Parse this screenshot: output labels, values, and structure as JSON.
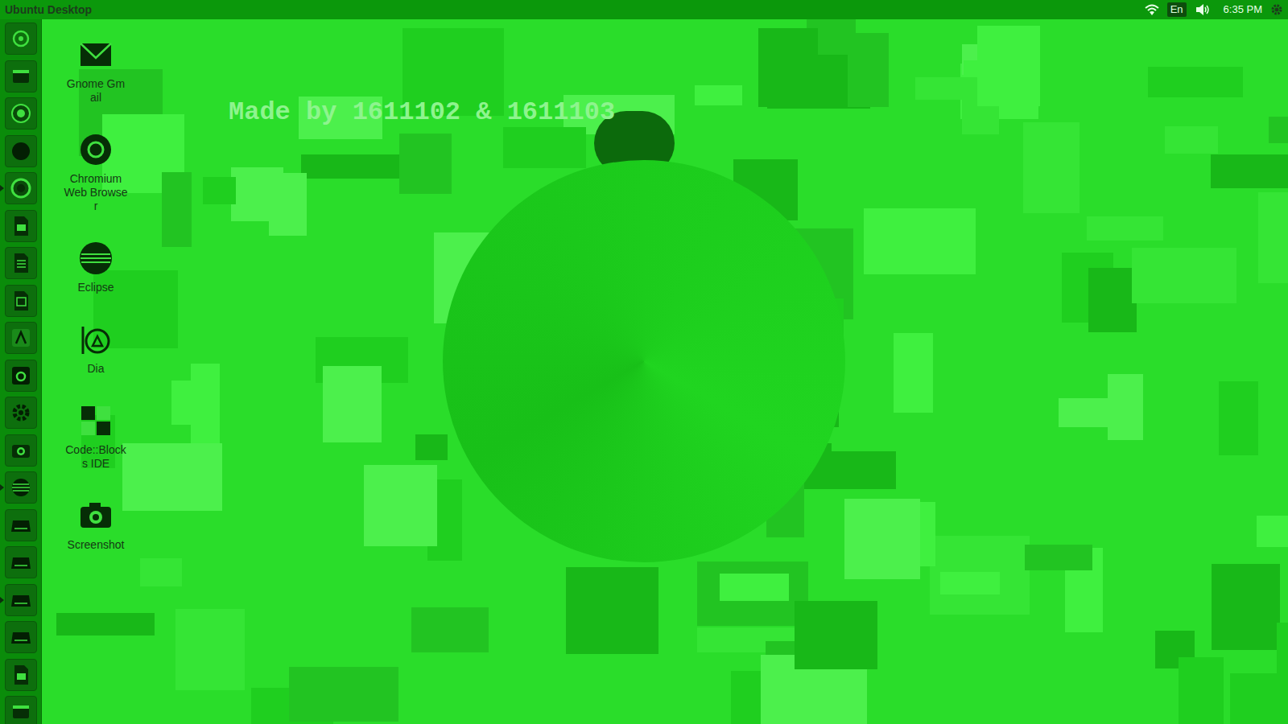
{
  "top_bar": {
    "title": "Ubuntu Desktop",
    "keyboard": "En",
    "clock": "6:35 PM"
  },
  "launcher": {
    "items": [
      {
        "running": false
      },
      {
        "running": false
      },
      {
        "running": false
      },
      {
        "running": false
      },
      {
        "running": true
      },
      {
        "running": false
      },
      {
        "running": false
      },
      {
        "running": false
      },
      {
        "running": false
      },
      {
        "running": false
      },
      {
        "running": false
      },
      {
        "running": false
      },
      {
        "running": true
      },
      {
        "running": false
      },
      {
        "running": false
      },
      {
        "running": true
      },
      {
        "running": false
      },
      {
        "running": false
      },
      {
        "running": false
      }
    ]
  },
  "desktop": {
    "watermark": "Made by 1611102 & 1611103",
    "icons": [
      {
        "label": "Gnome Gmail"
      },
      {
        "label": "Chromium Web Browser"
      },
      {
        "label": "Eclipse"
      },
      {
        "label": "Dia"
      },
      {
        "label": "Code::Blocks IDE"
      },
      {
        "label": "Screenshot"
      }
    ]
  }
}
